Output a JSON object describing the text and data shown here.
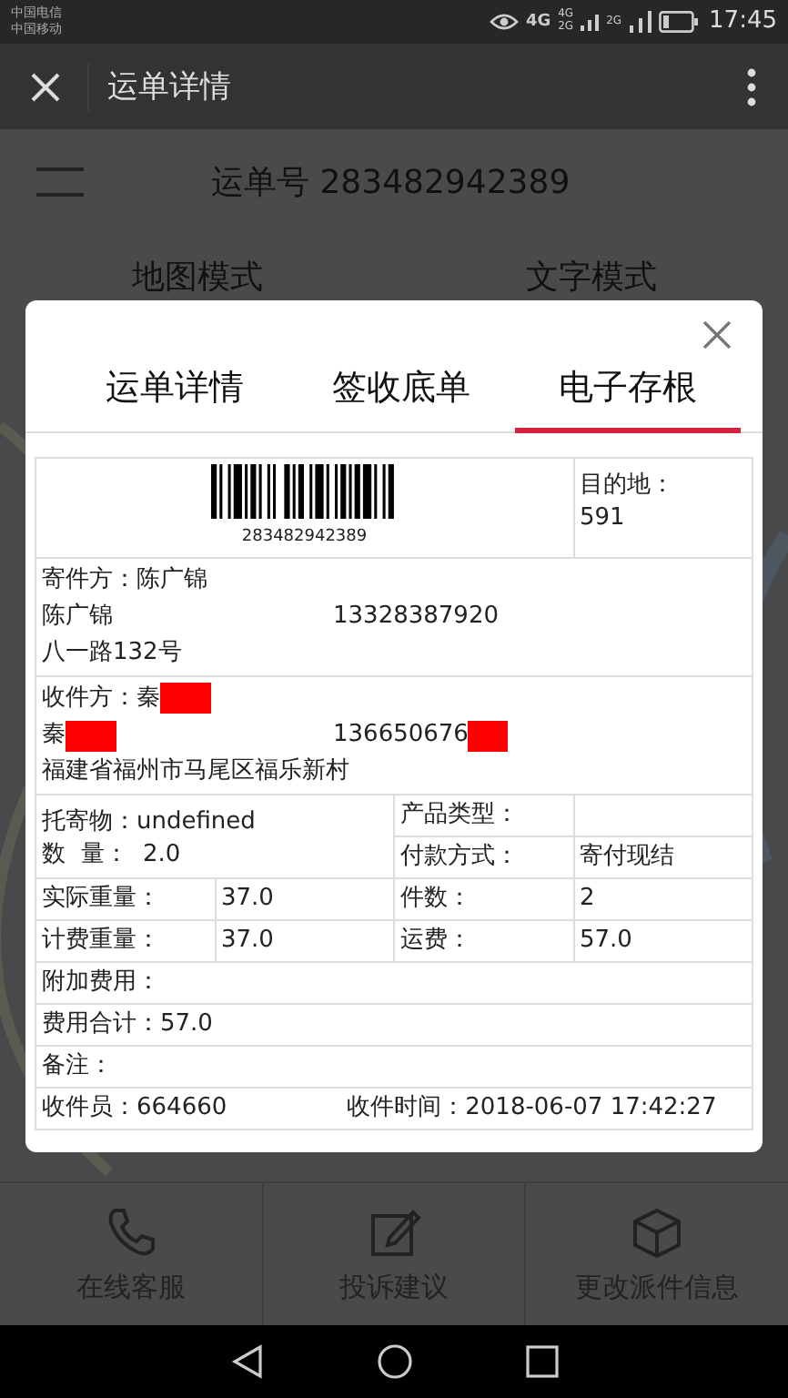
{
  "status_bar": {
    "carriers": [
      "中国电信",
      "中国移动"
    ],
    "network_labels": [
      "4G",
      "4G",
      "2G",
      "2G"
    ],
    "time": "17:45"
  },
  "header": {
    "title": "运单详情"
  },
  "page": {
    "waybill_title": "运单号 283482942389",
    "modes": [
      "地图模式",
      "文字模式"
    ]
  },
  "dialog": {
    "tabs": [
      {
        "label": "运单详情",
        "selected": false
      },
      {
        "label": "签收底单",
        "selected": false
      },
      {
        "label": "电子存根",
        "selected": true
      }
    ],
    "barcode": {
      "number": "283482942389"
    },
    "destination": {
      "label": "目的地：",
      "value": "591"
    },
    "sender": {
      "heading": "寄件方：陈广锦",
      "name": "陈广锦",
      "phone": "13328387920",
      "address": "八一路132号",
      "redacted": false
    },
    "receiver": {
      "heading": "收件方：秦",
      "name": "秦",
      "phone": "136650676",
      "address": "福建省福州市马尾区福乐新村",
      "redacted": true
    },
    "goods": "托寄物：undefined",
    "quantity": "数  量：  2.0",
    "product_type": {
      "label": "产品类型："
    },
    "payment": {
      "label": "付款方式：",
      "value": "寄付现结"
    },
    "weights": [
      {
        "label": "实际重量：",
        "value": "37.0",
        "label_2": "件数：",
        "value_2": "2"
      },
      {
        "label": "计费重量：",
        "value": "37.0",
        "label_2": "运费：",
        "value_2": "57.0"
      }
    ],
    "extra_fee": "附加费用：",
    "total": "费用合计：57.0",
    "remark": "备注：",
    "collector": "收件员：664660",
    "collect_time": "收件时间：2018-06-07 17:42:27"
  },
  "bottom_actions": [
    {
      "label": "在线客服",
      "kind": "phone"
    },
    {
      "label": "投诉建议",
      "kind": "edit"
    },
    {
      "label": "更改派件信息",
      "kind": "box"
    }
  ]
}
